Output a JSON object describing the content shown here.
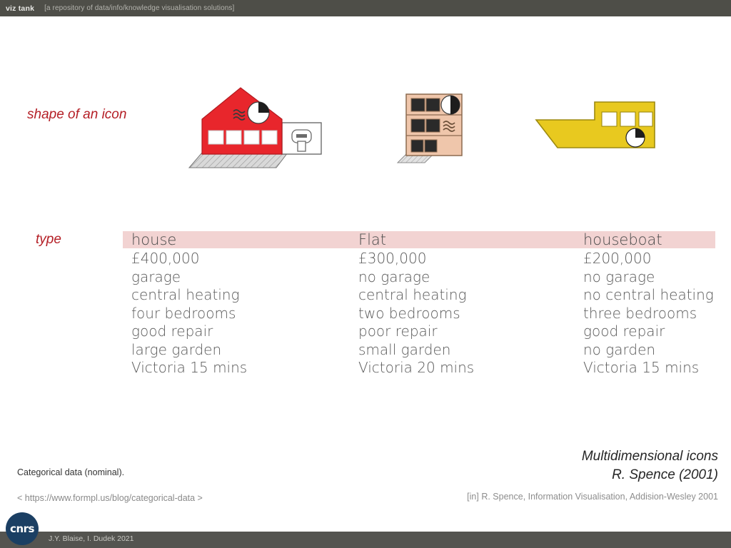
{
  "topbar": {
    "brand": "viz tank",
    "tagline": "[a repository of data/info/knowledge visualisation solutions]"
  },
  "annotations": {
    "shape_label": "shape of an icon",
    "type_label": "type"
  },
  "icons": [
    {
      "name": "house-icon",
      "shape": "house",
      "body_color": "#e8262c",
      "windows": 4,
      "has_garage": true,
      "has_waves": true,
      "has_garden": true,
      "pie_filled_quadrant": "upper-right"
    },
    {
      "name": "flat-icon",
      "shape": "flat",
      "body_color": "#efc6ab",
      "windows": 6,
      "has_garage": false,
      "has_waves": true,
      "has_garden": true,
      "pie_filled_quadrant": "right-half"
    },
    {
      "name": "houseboat-icon",
      "shape": "houseboat",
      "body_color": "#e8c91f",
      "windows": 3,
      "has_garage": false,
      "has_waves": false,
      "has_garden": false,
      "pie_filled_quadrant": "upper-right"
    }
  ],
  "table": {
    "band_color": "#f2d3d2",
    "columns": [
      {
        "header": "house",
        "rows": [
          "£400,000",
          "garage",
          "central heating",
          "four bedrooms",
          "good repair",
          "large garden",
          "Victoria 15 mins"
        ]
      },
      {
        "header": "Flat",
        "rows": [
          "£300,000",
          "no garage",
          "central heating",
          "two bedrooms",
          "poor repair",
          "small garden",
          "Victoria 20 mins"
        ]
      },
      {
        "header": "houseboat",
        "rows": [
          "£200,000",
          "no garage",
          "no central heating",
          "three bedrooms",
          "good repair",
          "no garden",
          "Victoria 15 mins"
        ]
      }
    ]
  },
  "notes": {
    "main": "Categorical data (nominal).",
    "source": "< https://www.formpl.us/blog/categorical-data >"
  },
  "credit": {
    "title": "Multidimensional icons",
    "author": "R. Spence  (2001)",
    "reference": "[in] R. Spence, Information Visualisation, Addision-Wesley 2001"
  },
  "footer": {
    "credit": "J.Y. Blaise,  I. Dudek 2021",
    "logo_text": "cnrs"
  }
}
